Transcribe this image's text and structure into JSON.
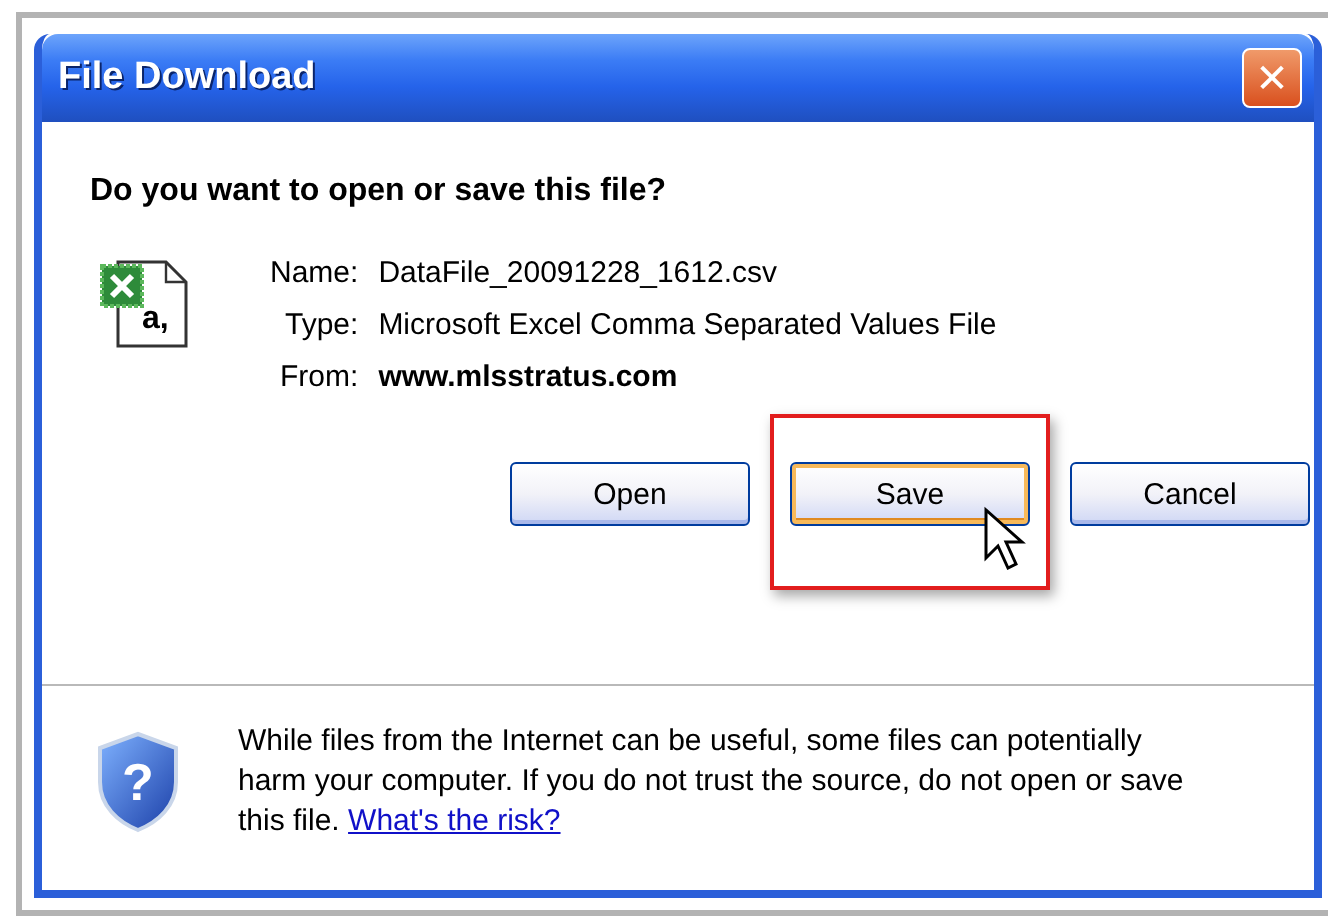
{
  "window": {
    "title": "File Download",
    "close": "✕"
  },
  "question": "Do you want to open or save this file?",
  "fields": [
    {
      "label": "Name:",
      "value": "DataFile_20091228_1612.csv",
      "bold": false
    },
    {
      "label": "Type:",
      "value": "Microsoft Excel Comma Separated Values File",
      "bold": false
    },
    {
      "label": "From:",
      "value": "www.mlsstratus.com",
      "bold": true
    }
  ],
  "file_icon_text": "a,",
  "buttons": [
    {
      "label": "Open",
      "focused": false,
      "highlighted": false
    },
    {
      "label": "Save",
      "focused": true,
      "highlighted": true
    },
    {
      "label": "Cancel",
      "focused": false,
      "highlighted": false
    }
  ],
  "warning": {
    "text": "While files from the Internet can be useful, some files can potentially harm your computer. If you do not trust the source, do not open or save this file.",
    "link": "What's the risk?",
    "shield_text": "?"
  }
}
